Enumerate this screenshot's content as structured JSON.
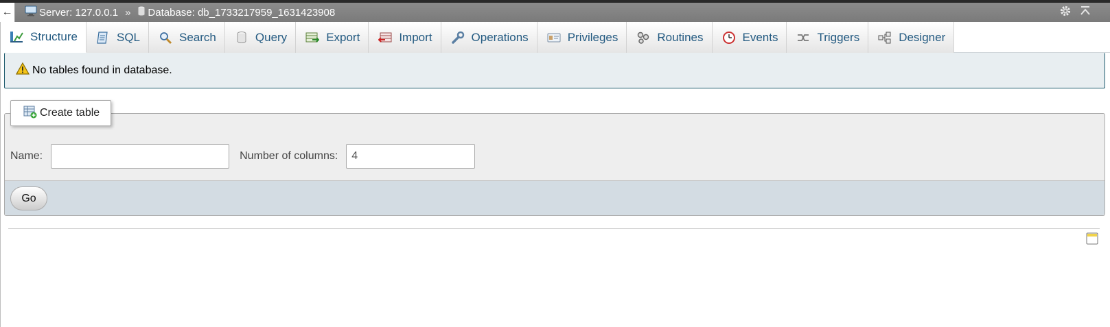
{
  "breadcrumb": {
    "back_glyph": "←",
    "server_label": "Server: 127.0.0.1",
    "separator": "»",
    "database_label": "Database: db_1733217959_1631423908"
  },
  "tabs": [
    {
      "label": "Structure",
      "icon": "structure-icon",
      "active": true
    },
    {
      "label": "SQL",
      "icon": "sql-icon"
    },
    {
      "label": "Search",
      "icon": "search-icon"
    },
    {
      "label": "Query",
      "icon": "query-icon"
    },
    {
      "label": "Export",
      "icon": "export-icon"
    },
    {
      "label": "Import",
      "icon": "import-icon"
    },
    {
      "label": "Operations",
      "icon": "wrench-icon"
    },
    {
      "label": "Privileges",
      "icon": "privileges-icon"
    },
    {
      "label": "Routines",
      "icon": "routines-icon"
    },
    {
      "label": "Events",
      "icon": "clock-icon"
    },
    {
      "label": "Triggers",
      "icon": "triggers-icon"
    },
    {
      "label": "Designer",
      "icon": "designer-icon"
    }
  ],
  "notice": {
    "text": "No tables found in database."
  },
  "create_table": {
    "legend": "Create table",
    "name_label": "Name:",
    "name_value": "",
    "columns_label": "Number of columns:",
    "columns_value": "4",
    "go_label": "Go"
  },
  "colors": {
    "tab_text": "#235a81",
    "notice_bg": "#e8eef1",
    "footer_bg": "#d3dce3"
  }
}
